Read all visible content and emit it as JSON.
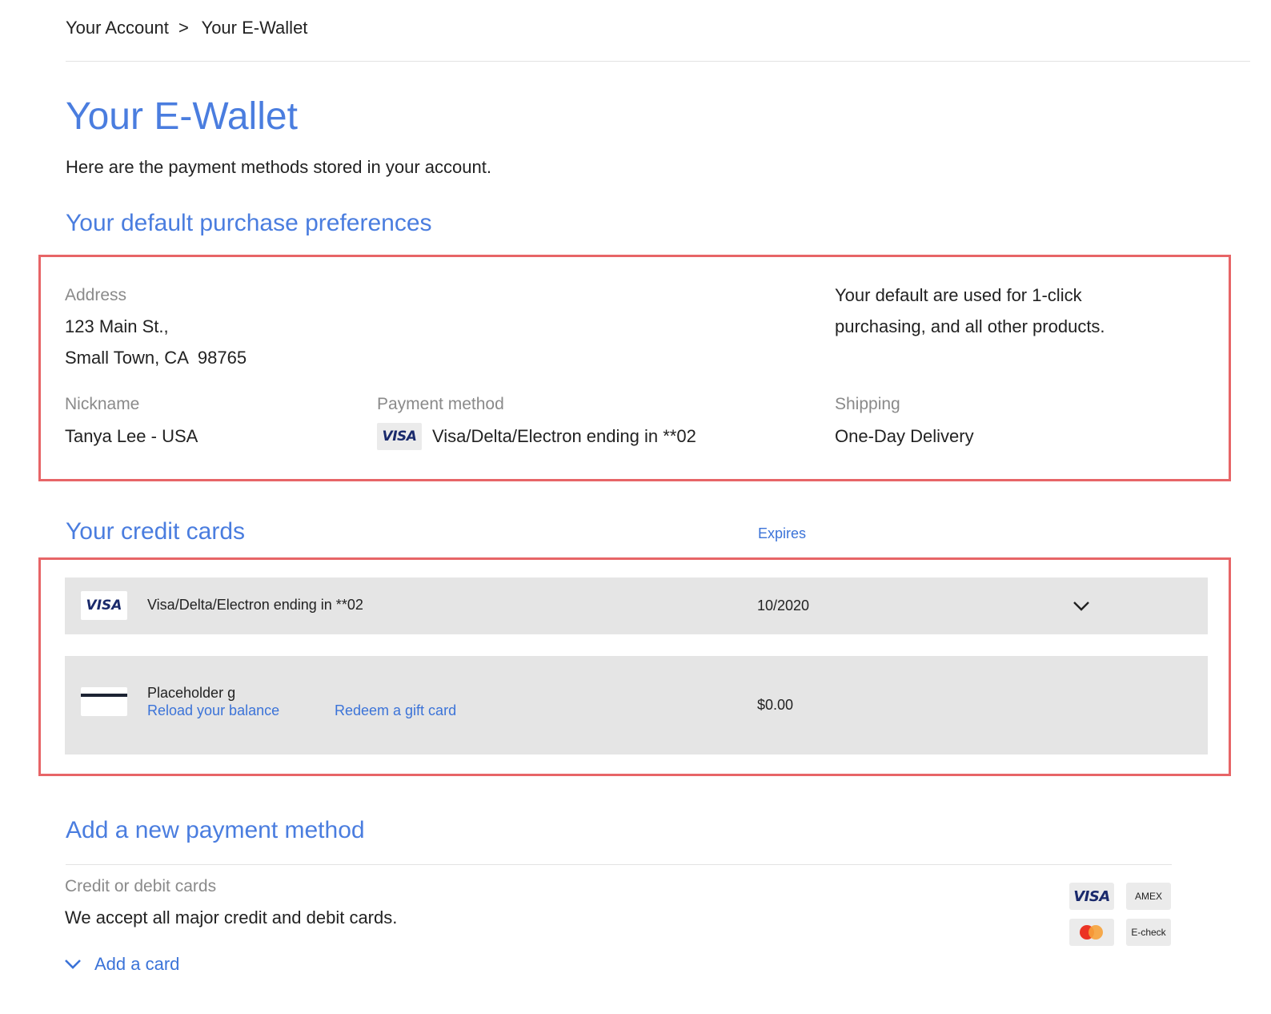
{
  "breadcrumb": {
    "account": "Your Account",
    "separator": ">",
    "current": "Your E-Wallet"
  },
  "page": {
    "title": "Your E-Wallet",
    "intro": "Here are the payment methods stored in your account."
  },
  "preferences": {
    "heading": "Your default purchase preferences",
    "address_label": "Address",
    "address_line1": "123 Main St.,",
    "address_line2": "Small Town, CA  98765",
    "note_line1": "Your default are used for 1-click",
    "note_line2": "purchasing, and all other products.",
    "nickname_label": "Nickname",
    "nickname_value": "Tanya Lee - USA",
    "payment_label": "Payment method",
    "payment_brand": "VISA",
    "payment_value": "Visa/Delta/Electron ending in **02",
    "shipping_label": "Shipping",
    "shipping_value": "One-Day Delivery"
  },
  "credit_cards": {
    "heading": "Your credit cards",
    "expires_header": "Expires",
    "cards": [
      {
        "brand": "VISA",
        "name": "Visa/Delta/Electron ending in **02",
        "expires": "10/2020",
        "icon": "chevron-down-icon"
      }
    ],
    "gift": {
      "name": "Placeholder g",
      "reload_link": "Reload your balance",
      "redeem_link": "Redeem a gift card",
      "balance": "$0.00"
    }
  },
  "add_payment": {
    "heading": "Add a new payment method",
    "cards_label": "Credit or debit cards",
    "cards_desc": "We accept all major credit and debit cards.",
    "add_card_link": "Add a card",
    "brands": {
      "visa": "VISA",
      "amex": "AMEX",
      "echeck": "E-check",
      "mastercard_icon": "mastercard-icon"
    }
  },
  "colors": {
    "accent": "#4a7ddf",
    "link": "#3b73d8",
    "highlight_border": "#e76567",
    "row_bg": "#e5e5e5"
  }
}
